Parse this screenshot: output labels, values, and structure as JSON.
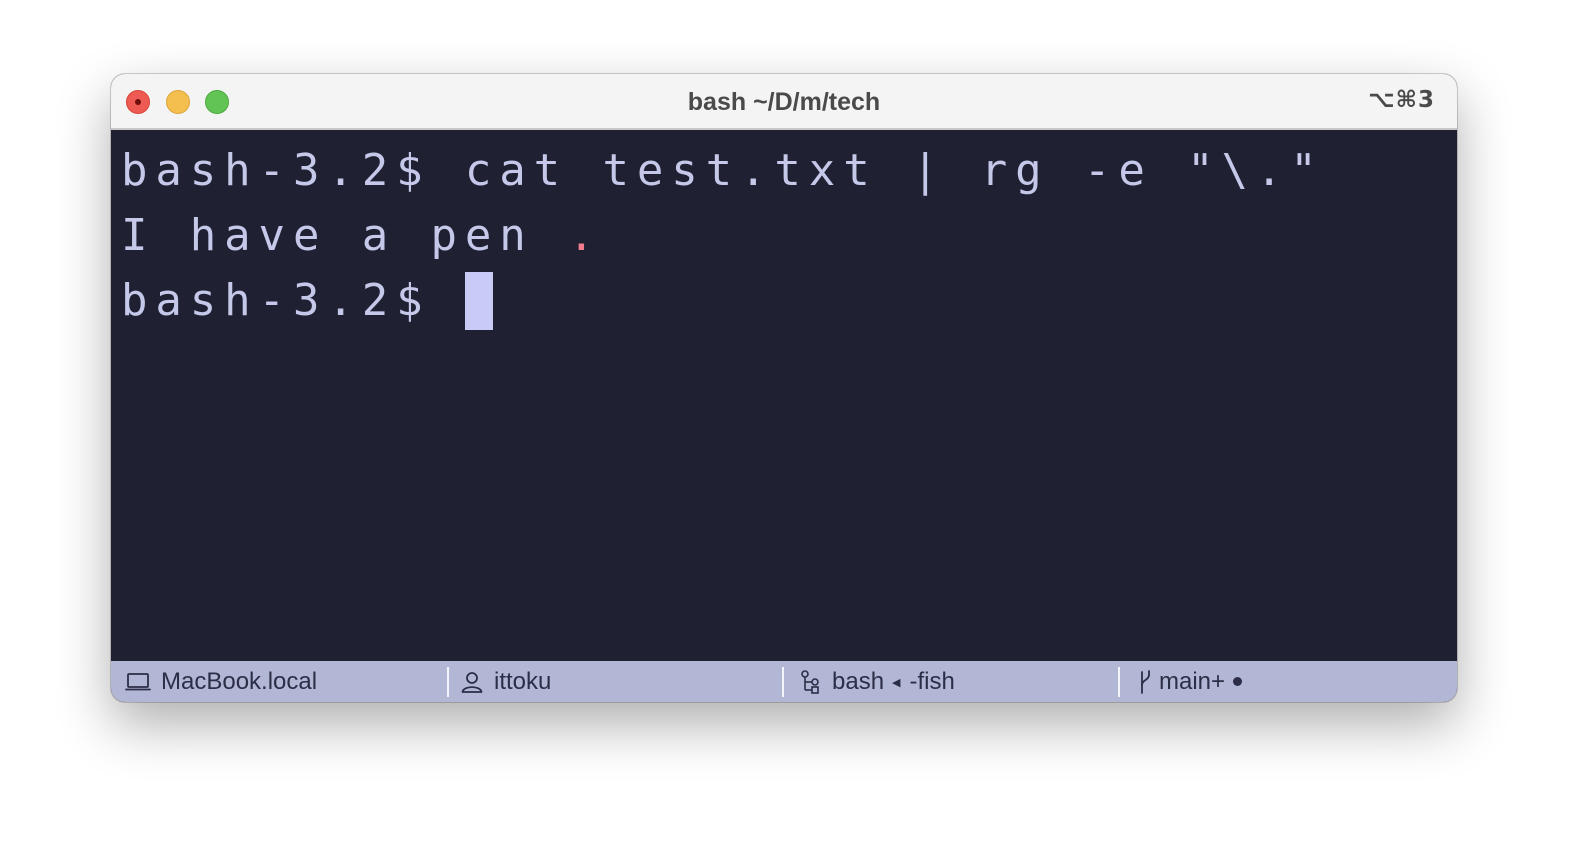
{
  "window": {
    "title": "bash ~/D/m/tech",
    "shortcut": "⌥⌘3"
  },
  "terminal": {
    "line1": "bash-3.2$ cat test.txt | rg -e \"\\.\"",
    "line2_prefix": "I have a pen ",
    "line2_match": ".",
    "line3_prompt": "bash-3.2$ "
  },
  "statusbar": {
    "host": "MacBook.local",
    "user": "ittoku",
    "process": "bash",
    "parent_process": "-fish",
    "branch": "main+"
  },
  "colors": {
    "terminal_bg": "#1f2133",
    "terminal_fg": "#c5c8e8",
    "match": "#f27b8e",
    "cursor": "#c8cbf6",
    "statusbar_bg": "#b3b7d6"
  }
}
